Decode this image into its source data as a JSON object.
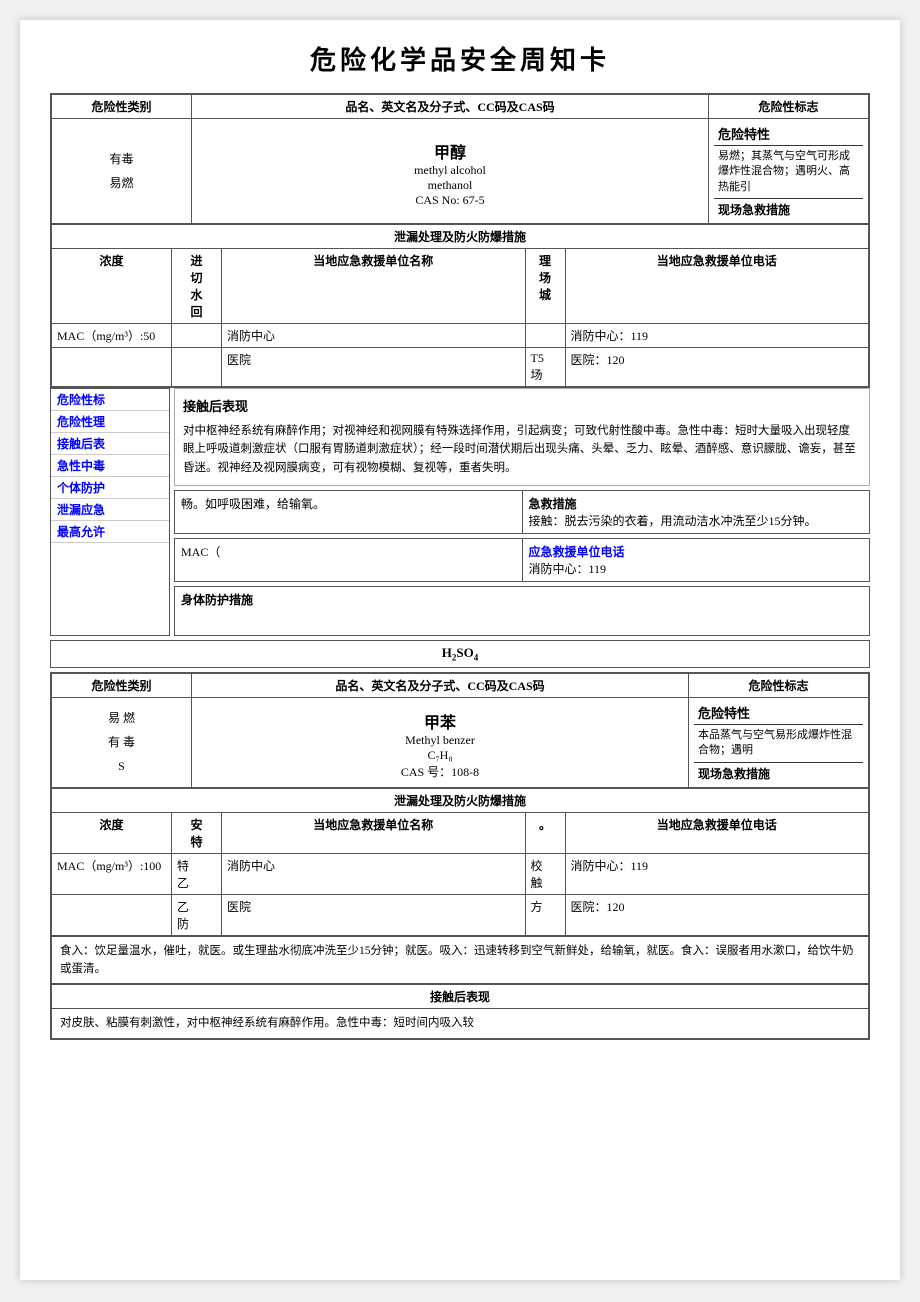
{
  "page": {
    "title": "危险化学品安全周知卡"
  },
  "card1": {
    "header": {
      "col1": "危险性类别",
      "col2": "品名、英文名及分子式、CC码及CAS码",
      "col3": "危险性标志"
    },
    "left": {
      "line1": "有毒",
      "line2": "易燃"
    },
    "middle": {
      "name": "甲醇",
      "en": "methyl alcohol",
      "formula": "methanol",
      "cas": "CAS No:  67-5"
    },
    "right": {
      "danger_label": "危险特性",
      "danger_text": "易燃；其蒸气与空气可形成爆炸性混合物；遇明火、高热能引",
      "rescue_label": "现场急救措施"
    }
  },
  "spill1": {
    "header": "泄漏处理及防火防爆措施",
    "conc_label": "浓度",
    "mac_label": "MAC（mg/m³）:50",
    "unit_label": "当地应急救援单位名称",
    "fire_center": "消防中心",
    "hospital": "医院",
    "tel_label": "当地应急救援单位电话",
    "fire_tel": "消防中心：119",
    "hospital_tel": "医院：120"
  },
  "blue_items": [
    "危险性标",
    "危险性理",
    "接触后表",
    "急性中毒",
    "个体防护",
    "泄漏应急",
    "最高允许"
  ],
  "popup": {
    "text": "对中枢神经系统有麻醉作用；对视神经和视网膜有特殊选择作用，引起病变；可致代射性酸中毒。急性中毒：短时大量吸入出现轻度眼上呼吸道刺激症状（口服有胃肠道刺激症状）；经一段时间潜伏期后出现头痛、头晕、乏力、眩晕、酒醉感、意识朦胧、谵妄，甚至昏迷。视神经及视网膜病变，可有视物模糊、复视等，重者失明。"
  },
  "rescue_right": {
    "text": "畅。如呼吸困难，给输氧。",
    "header": "急救措施",
    "contact_text": "接触：脱去污染的衣着，用流动洁水冲洗至少15分钟。"
  },
  "mac_section": {
    "label": "MAC（",
    "fire_tel2": "消防中心：119",
    "tel_header": "应急救援单位电话"
  },
  "body_protection": {
    "header": "身体防护措施"
  },
  "card2": {
    "h2so4": "H₂SO₄",
    "header": {
      "col1": "危险性类别",
      "col2": "品名、英文名及分子式、CC码及CAS码",
      "col3": "危险性标志"
    },
    "left": {
      "line1": "易 燃",
      "line2": "有 毒"
    },
    "middle": {
      "name": "甲苯",
      "en": "Methyl benzer",
      "formula": "C₇H₈",
      "cas": "CAS 号：108-8"
    },
    "right": {
      "danger_label": "危险特性",
      "danger_text": "本品蒸气与空气易形成爆炸性混合物；遇明",
      "rescue_label": "现场急救措施"
    }
  },
  "spill2": {
    "header": "泄漏处理及防火防爆措施",
    "conc_label": "浓度",
    "mac_label": "MAC（mg/m³）:100",
    "unit_label": "当地应急救援单位名称",
    "fire_center": "消防中心",
    "hospital": "医院",
    "tel_label": "当地应急救援单位电话",
    "fire_tel": "消防中心：119",
    "hospital_tel": "医院：120"
  },
  "card2_bottom": {
    "rescue_note": "食入：饮足量温水，催吐，就医。或生理盐水彻底冲洗至少15分钟；就医。吸入：迅速转移到空气新鲜处，给输氧，就医。食入：误服者用水漱口，给饮牛奶或蛋清。",
    "contact_header": "接触后表现",
    "contact_text": "对皮肤、粘膜有刺激性，对中枢神经系统有麻醉作用。急性中毒：短时间内吸入较"
  }
}
